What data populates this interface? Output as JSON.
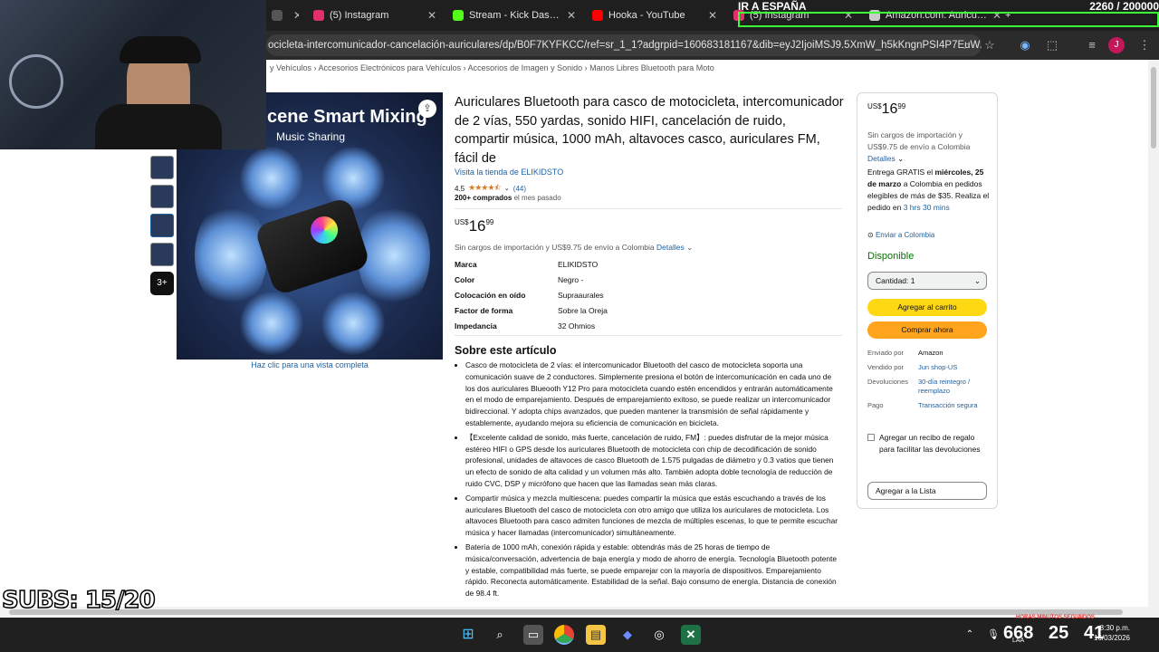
{
  "browser": {
    "tabs": [
      {
        "label": "po",
        "favicon": "generic-icon",
        "color": "#555555"
      },
      {
        "label": "(5) Instagram",
        "favicon": "instagram-icon",
        "color": "#e1306c"
      },
      {
        "label": "Stream - Kick Dashboa",
        "favicon": "kick-icon",
        "color": "#53fc18"
      },
      {
        "label": "Hooka - YouTube",
        "favicon": "youtube-icon",
        "color": "#ff0000"
      },
      {
        "label": "(5) Instagram",
        "favicon": "instagram-icon",
        "color": "#e1306c"
      },
      {
        "label": "Amazon.com: Auricul...",
        "favicon": "amazon-icon",
        "color": "#cccccc"
      }
    ],
    "new_tab": "+",
    "url": "ocicleta-intercomunicador-cancelación-auriculares/dp/B0F7KYFKCC/ref=sr_1_1?adgrpid=160683181167&dib=eyJ2IjoiMSJ9.5XmW_h5kKngnPSI4P7EuW...",
    "profile_initial": "J"
  },
  "overlay": {
    "promo": "IR A ESPAÑA",
    "counter": "2260 / 200000",
    "subs": "SUBS: 15/20",
    "timer_h": "668",
    "timer_m": "25",
    "timer_s": "41",
    "timer_labels": "HORAS    MINUTOS    SEGUNDOS"
  },
  "product": {
    "breadcrumb": "y Vehículos  ›  Accesorios Electrónicos para Vehículos  ›  Accesorios de Imagen y Sonido  ›  Manos Libres Bluetooth para Moto",
    "image_heading": "cene Smart Mixing",
    "image_subheading": "Music Sharing",
    "thumb_more": "3+",
    "full_view": "Haz clic para una vista completa",
    "title": "Auriculares Bluetooth para casco de motocicleta, intercomunicador de 2 vías, 550 yardas, sonido HIFI, cancelación de ruido, compartir música, 1000 mAh, altavoces casco, auriculares FM, fácil de",
    "store": "Visita la tienda de ELIKIDSTO",
    "rating": "4.5",
    "rating_stars": 4.5,
    "reviews": "(44)",
    "bought_bold": "200+ comprados",
    "bought_rest": "el mes pasado",
    "currency": "US$",
    "price_whole": "16",
    "price_frac": "99",
    "shipping": "Sin cargos de importación y US$9.75 de envío a Colombia",
    "details_link": "Detalles",
    "specs": [
      {
        "k": "Marca",
        "v": "ELIKIDSTO"
      },
      {
        "k": "Color",
        "v": "Negro -"
      },
      {
        "k": "Colocación en oído",
        "v": "Supraaurales"
      },
      {
        "k": "Factor de forma",
        "v": "Sobre la Oreja"
      },
      {
        "k": "Impedancia",
        "v": "32 Ohmios"
      }
    ],
    "about_heading": "Sobre este artículo",
    "bullets": [
      "Casco de motocicleta de 2 vías: el intercomunicador Bluetooth del casco de motocicleta soporta una comunicación suave de 2 conductores. Simplemente presiona el botón de intercomunicación en cada uno de los dos auriculares Blueooth Y12 Pro para motocicleta cuando estén encendidos y entrarán automáticamente en el modo de emparejamiento. Después de emparejamiento exitoso, se puede realizar un intercomunicador bidireccional. Y adopta chips avanzados, que pueden mantener la transmisión de señal rápidamente y establemente, ayudando mejora su eficiencia de comunicación en bicicleta.",
      "【Excelente calidad de sonido, más fuerte, cancelación de ruido, FM】: puedes disfrutar de la mejor música estéreo HIFI o GPS desde los auriculares Bluetooth de motocicleta con chip de decodificación de sonido profesional, unidades de altavoces de casco Bluetooth de 1.575 pulgadas de diámetro y 0.3 vatios que tienen un efecto de sonido de alta calidad y un volumen más alto. También adopta doble tecnología de reducción de ruido CVC, DSP y micrófono que hacen que las llamadas sean más claras.",
      "Compartir música y mezcla multiescena: puedes compartir la música que estás escuchando a través de los auriculares Bluetooth del casco de motocicleta con otro amigo que utiliza los auriculares de motocicleta. Los altavoces Bluetooth para casco admiten funciones de mezcla de múltiples escenas, lo que te permite escuchar música y hacer llamadas (intercomunicador) simultáneamente.",
      "Batería de 1000 mAh, conexión rápida y estable: obtendrás más de 25 horas de tiempo de música/conversación, advertencia de baja energía y modo de ahorro de energía. Tecnología Bluetooth potente y estable, compatibilidad más fuerte, se puede emparejar con la mayoría de dispositivos. Emparejamiento rápido. Reconecta automáticamente. Estabilidad de la señal. Bajo consumo de energía. Distancia de conexión de 98.4 ft."
    ]
  },
  "buybox": {
    "currency": "US$",
    "price_whole": "16",
    "price_frac": "99",
    "shipping": "Sin cargos de importación y US$9.75 de envío a Colombia",
    "details": "Detalles",
    "delivery_pre": "Entrega GRATIS el ",
    "delivery_date": "miércoles, 25 de marzo",
    "delivery_post": " a Colombia en pedidos elegibles de más de $35. Realiza el pedido en ",
    "delivery_time": "3 hrs 30 mins",
    "location": "Enviar a Colombia",
    "availability": "Disponible",
    "quantity": "Cantidad: 1",
    "add_to_cart": "Agregar al carrito",
    "buy_now": "Comprar ahora",
    "info": [
      {
        "k": "Enviado por",
        "v": "Amazon",
        "link": false
      },
      {
        "k": "Vendido por",
        "v": "Jun shop-US",
        "link": true
      },
      {
        "k": "Devoluciones",
        "v": "30-día reintegro / reemplazo",
        "link": true
      },
      {
        "k": "Pago",
        "v": "Transacción segura",
        "link": true
      }
    ],
    "gift": "Agregar un recibo de regalo para facilitar las devoluciones",
    "add_to_list": "Agregar a la Lista"
  },
  "taskbar": {
    "clock_time": "8:30 p.m.",
    "clock_date": "16/03/2026",
    "lang": "LAA"
  }
}
